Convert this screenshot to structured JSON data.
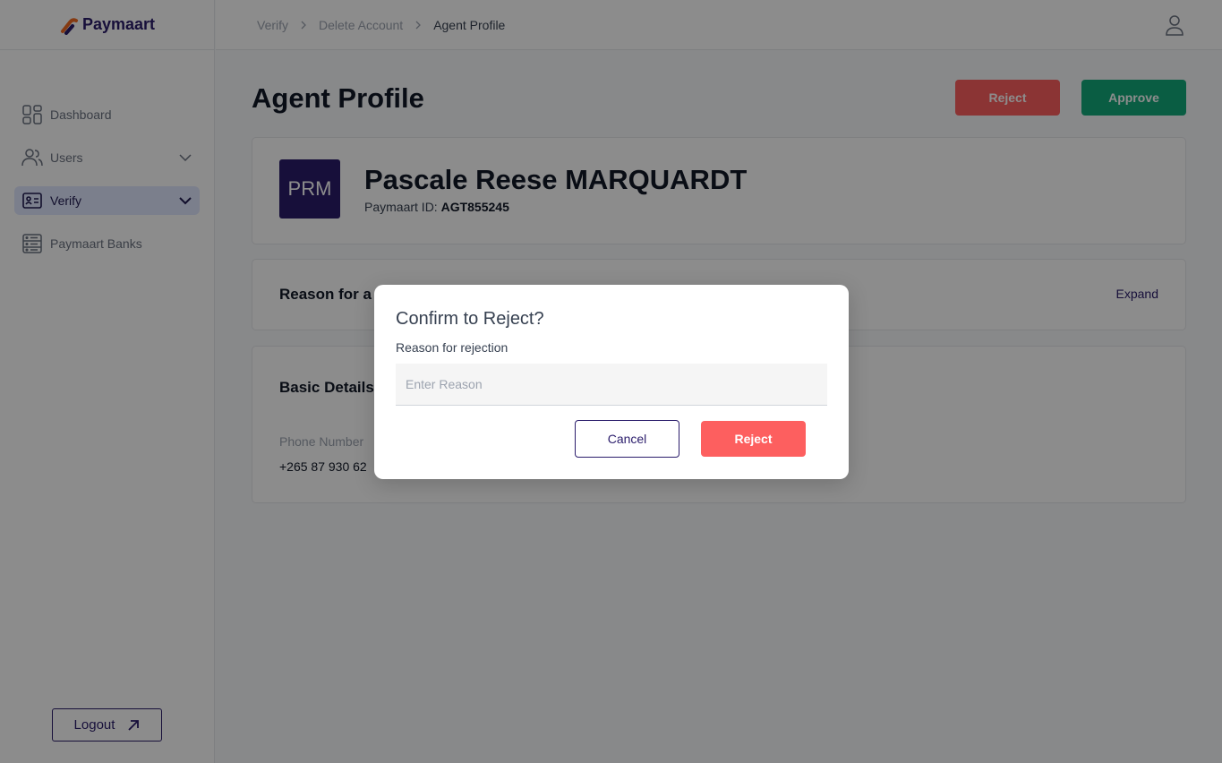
{
  "app": {
    "brand": "Paymaart"
  },
  "colors": {
    "brand": "#2a1c6b",
    "reject": "#fd5f5f",
    "approve": "#13a97a",
    "active_nav_bg": "#e0e7ff"
  },
  "sidebar": {
    "items": [
      {
        "label": "Dashboard",
        "icon": "dashboard-icon"
      },
      {
        "label": "Users",
        "icon": "users-icon"
      },
      {
        "label": "Verify",
        "icon": "id-card-icon"
      },
      {
        "label": "Paymaart Banks",
        "icon": "bank-icon"
      }
    ],
    "logout_label": "Logout"
  },
  "breadcrumb": [
    "Verify",
    "Delete Account",
    "Agent Profile"
  ],
  "page": {
    "title": "Agent Profile",
    "reject_label": "Reject",
    "approve_label": "Approve"
  },
  "profile": {
    "initials": "PRM",
    "name": "Pascale Reese MARQUARDT",
    "id_label": "Paymaart ID:",
    "id_value": "AGT855245"
  },
  "reason_section": {
    "title": "Reason for a",
    "expand_label": "Expand"
  },
  "basic_details": {
    "title": "Basic Details",
    "phone_label": "Phone Number",
    "phone_value": "+265 87 930 62"
  },
  "modal": {
    "title": "Confirm to Reject?",
    "field_label": "Reason for rejection",
    "placeholder": "Enter Reason",
    "value": "",
    "cancel_label": "Cancel",
    "reject_label": "Reject"
  }
}
